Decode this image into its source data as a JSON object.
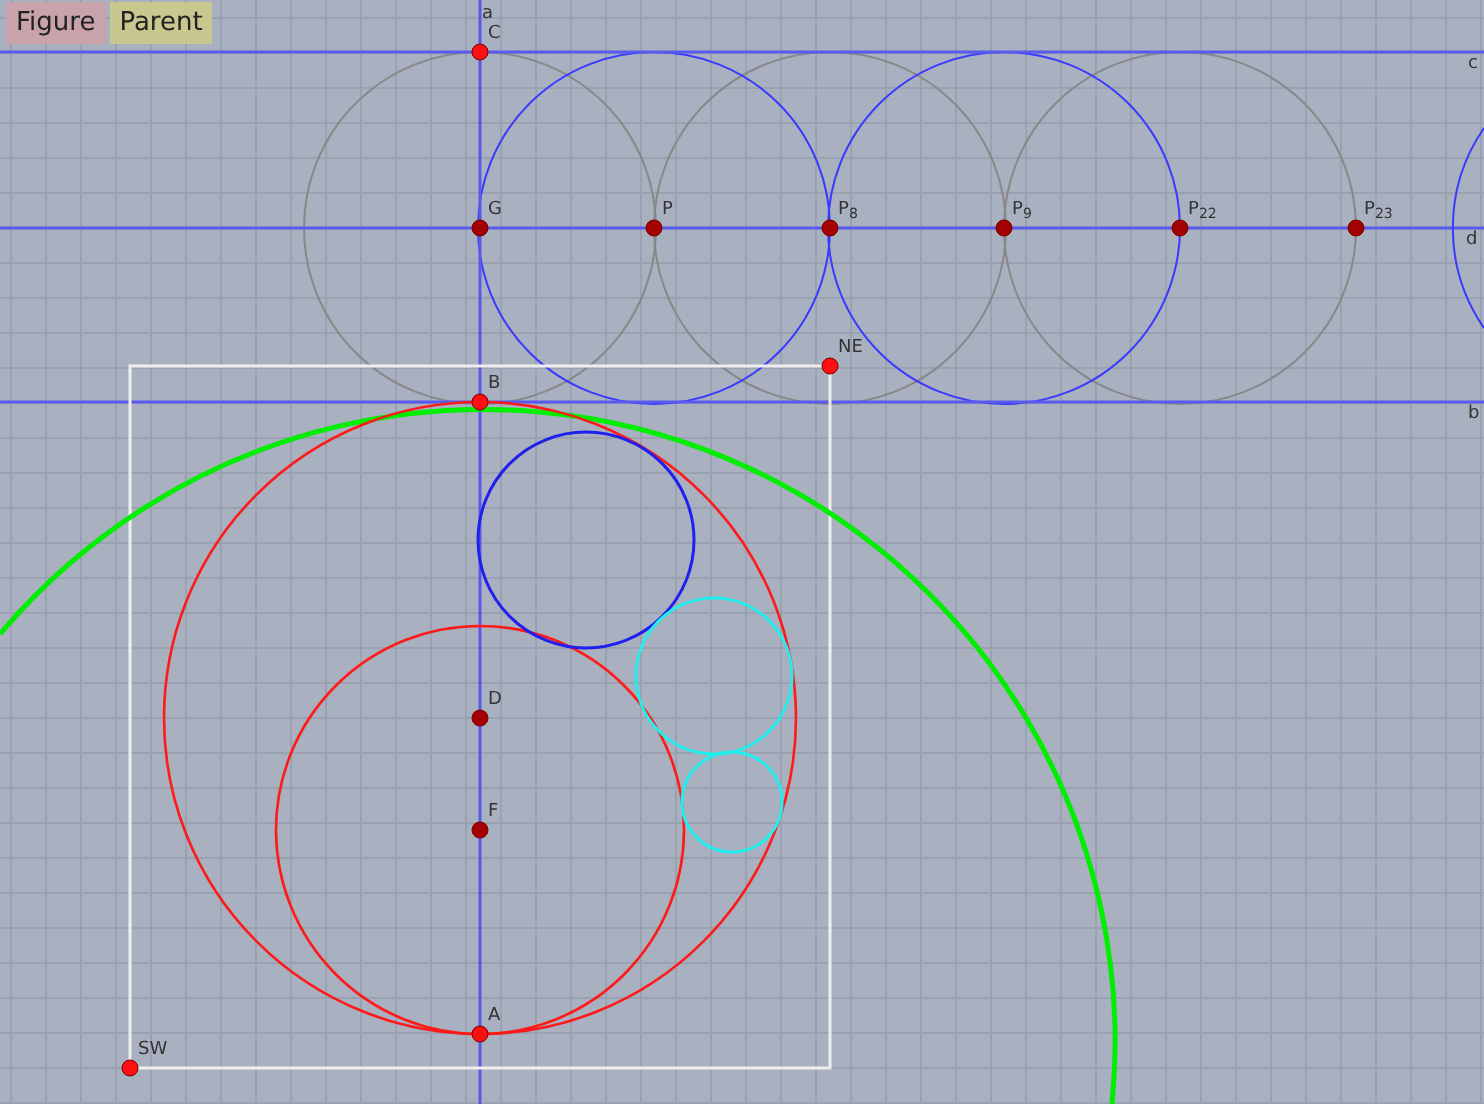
{
  "tabs": [
    {
      "label": "Figure",
      "color": "#c9a3ab"
    },
    {
      "label": "Parent",
      "color": "#c7c78f"
    }
  ],
  "lines": [
    {
      "label": "a"
    },
    {
      "label": "c"
    },
    {
      "label": "d"
    },
    {
      "label": "b"
    }
  ],
  "points": [
    {
      "label": "C",
      "kind": "free"
    },
    {
      "label": "G",
      "kind": "fixed"
    },
    {
      "label": "P",
      "kind": "fixed"
    },
    {
      "label": "P$_{8}$",
      "kind": "fixed"
    },
    {
      "label": "P$_{9}$",
      "kind": "fixed"
    },
    {
      "label": "P$_{22}$",
      "kind": "fixed"
    },
    {
      "label": "P$_{23}$",
      "kind": "fixed"
    },
    {
      "label": "NE",
      "kind": "free"
    },
    {
      "label": "B",
      "kind": "free"
    },
    {
      "label": "D",
      "kind": "fixed"
    },
    {
      "label": "F",
      "kind": "fixed"
    },
    {
      "label": "A",
      "kind": "free"
    },
    {
      "label": "SW",
      "kind": "free"
    }
  ]
}
